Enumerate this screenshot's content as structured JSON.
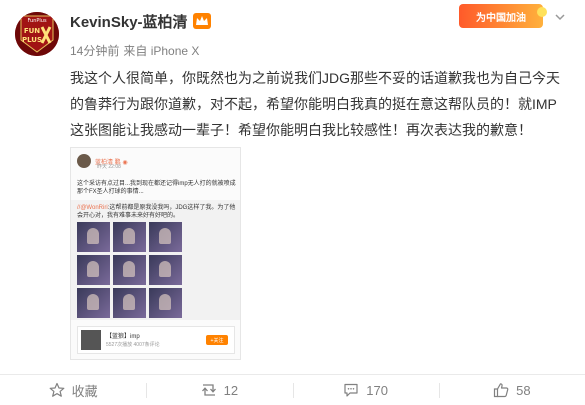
{
  "post": {
    "user": {
      "name": "KevinSky-蓝柏清",
      "avatar_text_top": "FunPlus",
      "avatar_text_mid": "FUN",
      "avatar_text_bottom": "PLUS"
    },
    "meta": {
      "time": "14分钟前",
      "source": "来自 iPhone X"
    },
    "campaign_badge": "为中国加油",
    "content": "我这个人很简单，你既然也为之前说我们JDG那些不妥的话道歉我也为自己今天的鲁莽行为跟你道歉，对不起，希望你能明白我真的挺在意这帮队员的！就IMP这张图能让我感动一辈子！希望你能明白我比较感性！再次表达我的歉意！",
    "image": {
      "user_name": "蓝柏清 鹏 ◉",
      "time": "昨天 22:08",
      "text": "这个采访有点过目...我到现在都还记得imp无人打的就被喷成那个FX圣人打球的事情...",
      "quote_at": "//@WonRiri",
      "quote_text": ":这帮前都是原我没我吗，JDG这样了我。为了他会开心对，我有难事未来好有好吧的。",
      "card_title": "【蓝狼】imp",
      "card_sub": "5527次播放 4007条评论",
      "card_button": "+关注"
    },
    "actions": {
      "favorite_label": "收藏",
      "repost_count": "12",
      "comment_count": "170",
      "like_count": "58"
    },
    "colors": {
      "accent_orange": "#ff8200",
      "link_orange": "#eb7350",
      "avatar_red": "#7a0a0a"
    }
  }
}
